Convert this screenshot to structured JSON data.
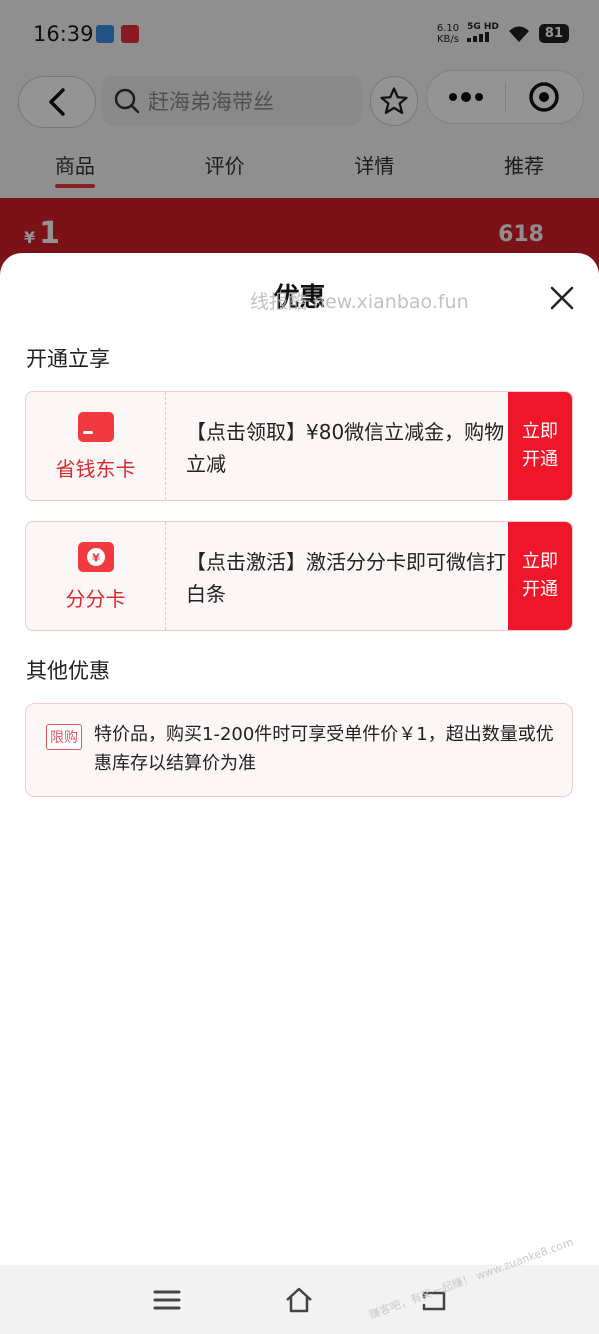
{
  "status_bar": {
    "time": "16:39",
    "net_speed_value": "6.10",
    "net_speed_unit": "KB/s",
    "signal_label": "5G HD",
    "battery": "81"
  },
  "nav": {
    "search_placeholder": "赶海弟海带丝"
  },
  "tabs": [
    "商品",
    "评价",
    "详情",
    "推荐"
  ],
  "banner": {
    "currency": "¥",
    "price": "1",
    "event": "618"
  },
  "sheet": {
    "title": "优惠",
    "watermark": "线报酷 new.xianbao.fun",
    "section_open": "开通立享",
    "cards": [
      {
        "icon": "card-icon",
        "label": "省钱东卡",
        "desc": "【点击领取】¥80微信立减金，购物立减",
        "button": "立即开通"
      },
      {
        "icon": "yen-voucher-icon",
        "label": "分分卡",
        "desc": "【点击激活】激活分分卡即可微信打白条",
        "button": "立即开通"
      }
    ],
    "section_other": "其他优惠",
    "promo": {
      "tag": "限购",
      "text": "特价品，购买1-200件时可享受单件价￥1，超出数量或优惠库存以结算价为准"
    }
  },
  "corner_watermark": "赚客吧，有奖一起赚！ www.zuanke8.com",
  "colors": {
    "accent": "#f0162a",
    "card_border": "#f4c9cc",
    "card_bg": "#fdf6f6"
  }
}
